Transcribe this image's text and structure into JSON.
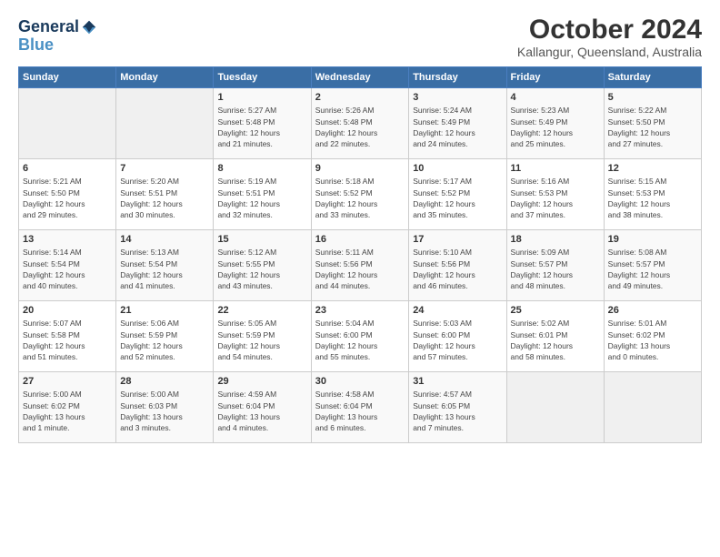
{
  "logo": {
    "line1": "General",
    "line2": "Blue"
  },
  "title": "October 2024",
  "subtitle": "Kallangur, Queensland, Australia",
  "days_of_week": [
    "Sunday",
    "Monday",
    "Tuesday",
    "Wednesday",
    "Thursday",
    "Friday",
    "Saturday"
  ],
  "weeks": [
    [
      {
        "day": "",
        "info": ""
      },
      {
        "day": "",
        "info": ""
      },
      {
        "day": "1",
        "info": "Sunrise: 5:27 AM\nSunset: 5:48 PM\nDaylight: 12 hours\nand 21 minutes."
      },
      {
        "day": "2",
        "info": "Sunrise: 5:26 AM\nSunset: 5:48 PM\nDaylight: 12 hours\nand 22 minutes."
      },
      {
        "day": "3",
        "info": "Sunrise: 5:24 AM\nSunset: 5:49 PM\nDaylight: 12 hours\nand 24 minutes."
      },
      {
        "day": "4",
        "info": "Sunrise: 5:23 AM\nSunset: 5:49 PM\nDaylight: 12 hours\nand 25 minutes."
      },
      {
        "day": "5",
        "info": "Sunrise: 5:22 AM\nSunset: 5:50 PM\nDaylight: 12 hours\nand 27 minutes."
      }
    ],
    [
      {
        "day": "6",
        "info": "Sunrise: 5:21 AM\nSunset: 5:50 PM\nDaylight: 12 hours\nand 29 minutes."
      },
      {
        "day": "7",
        "info": "Sunrise: 5:20 AM\nSunset: 5:51 PM\nDaylight: 12 hours\nand 30 minutes."
      },
      {
        "day": "8",
        "info": "Sunrise: 5:19 AM\nSunset: 5:51 PM\nDaylight: 12 hours\nand 32 minutes."
      },
      {
        "day": "9",
        "info": "Sunrise: 5:18 AM\nSunset: 5:52 PM\nDaylight: 12 hours\nand 33 minutes."
      },
      {
        "day": "10",
        "info": "Sunrise: 5:17 AM\nSunset: 5:52 PM\nDaylight: 12 hours\nand 35 minutes."
      },
      {
        "day": "11",
        "info": "Sunrise: 5:16 AM\nSunset: 5:53 PM\nDaylight: 12 hours\nand 37 minutes."
      },
      {
        "day": "12",
        "info": "Sunrise: 5:15 AM\nSunset: 5:53 PM\nDaylight: 12 hours\nand 38 minutes."
      }
    ],
    [
      {
        "day": "13",
        "info": "Sunrise: 5:14 AM\nSunset: 5:54 PM\nDaylight: 12 hours\nand 40 minutes."
      },
      {
        "day": "14",
        "info": "Sunrise: 5:13 AM\nSunset: 5:54 PM\nDaylight: 12 hours\nand 41 minutes."
      },
      {
        "day": "15",
        "info": "Sunrise: 5:12 AM\nSunset: 5:55 PM\nDaylight: 12 hours\nand 43 minutes."
      },
      {
        "day": "16",
        "info": "Sunrise: 5:11 AM\nSunset: 5:56 PM\nDaylight: 12 hours\nand 44 minutes."
      },
      {
        "day": "17",
        "info": "Sunrise: 5:10 AM\nSunset: 5:56 PM\nDaylight: 12 hours\nand 46 minutes."
      },
      {
        "day": "18",
        "info": "Sunrise: 5:09 AM\nSunset: 5:57 PM\nDaylight: 12 hours\nand 48 minutes."
      },
      {
        "day": "19",
        "info": "Sunrise: 5:08 AM\nSunset: 5:57 PM\nDaylight: 12 hours\nand 49 minutes."
      }
    ],
    [
      {
        "day": "20",
        "info": "Sunrise: 5:07 AM\nSunset: 5:58 PM\nDaylight: 12 hours\nand 51 minutes."
      },
      {
        "day": "21",
        "info": "Sunrise: 5:06 AM\nSunset: 5:59 PM\nDaylight: 12 hours\nand 52 minutes."
      },
      {
        "day": "22",
        "info": "Sunrise: 5:05 AM\nSunset: 5:59 PM\nDaylight: 12 hours\nand 54 minutes."
      },
      {
        "day": "23",
        "info": "Sunrise: 5:04 AM\nSunset: 6:00 PM\nDaylight: 12 hours\nand 55 minutes."
      },
      {
        "day": "24",
        "info": "Sunrise: 5:03 AM\nSunset: 6:00 PM\nDaylight: 12 hours\nand 57 minutes."
      },
      {
        "day": "25",
        "info": "Sunrise: 5:02 AM\nSunset: 6:01 PM\nDaylight: 12 hours\nand 58 minutes."
      },
      {
        "day": "26",
        "info": "Sunrise: 5:01 AM\nSunset: 6:02 PM\nDaylight: 13 hours\nand 0 minutes."
      }
    ],
    [
      {
        "day": "27",
        "info": "Sunrise: 5:00 AM\nSunset: 6:02 PM\nDaylight: 13 hours\nand 1 minute."
      },
      {
        "day": "28",
        "info": "Sunrise: 5:00 AM\nSunset: 6:03 PM\nDaylight: 13 hours\nand 3 minutes."
      },
      {
        "day": "29",
        "info": "Sunrise: 4:59 AM\nSunset: 6:04 PM\nDaylight: 13 hours\nand 4 minutes."
      },
      {
        "day": "30",
        "info": "Sunrise: 4:58 AM\nSunset: 6:04 PM\nDaylight: 13 hours\nand 6 minutes."
      },
      {
        "day": "31",
        "info": "Sunrise: 4:57 AM\nSunset: 6:05 PM\nDaylight: 13 hours\nand 7 minutes."
      },
      {
        "day": "",
        "info": ""
      },
      {
        "day": "",
        "info": ""
      }
    ]
  ]
}
